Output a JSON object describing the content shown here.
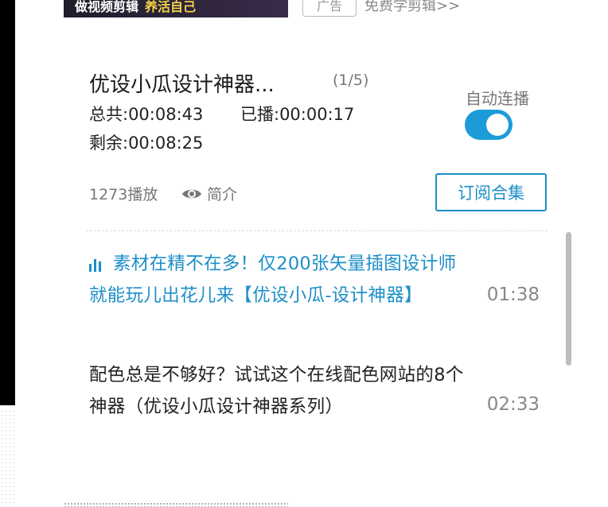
{
  "ad": {
    "banner_text": "做视频剪辑",
    "banner_highlight": "养活自己",
    "tag": "广告",
    "link": "免费学剪辑>>"
  },
  "playlist": {
    "title": "优设小瓜设计神器...",
    "position": "(1/5)",
    "total": "总共:00:08:43",
    "played": "已播:00:00:17",
    "remaining": "剩余:00:08:25",
    "autoplay_label": "自动连播",
    "autoplay_on": true,
    "plays": "1273播放",
    "intro": "简介",
    "subscribe": "订阅合集"
  },
  "episodes": [
    {
      "title": "素材在精不在多！仅200张矢量插图设计师就能玩儿出花儿来【优设小瓜-设计神器】",
      "duration": "01:38",
      "active": true
    },
    {
      "title": "配色总是不够好？试试这个在线配色网站的8个神器（优设小瓜设计神器系列）",
      "duration": "02:33",
      "active": false
    }
  ],
  "colors": {
    "accent": "#1c8fc8",
    "toggle": "#1c9bd8"
  },
  "icons": {
    "intro": "eye-icon",
    "playing": "playing-bars-icon"
  }
}
